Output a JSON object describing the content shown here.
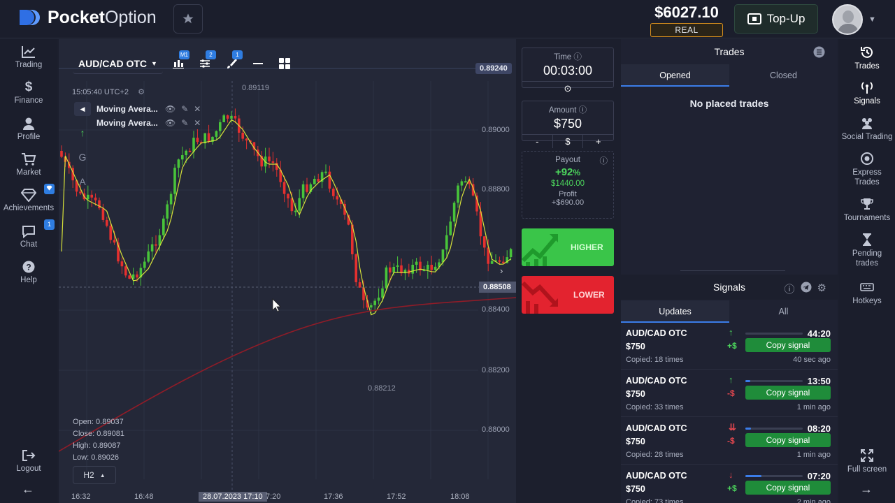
{
  "header": {
    "logo_bold": "Pocket",
    "logo_light": "Option",
    "balance": "$6027.10",
    "account_type": "REAL",
    "topup_label": "Top-Up",
    "colors": {
      "accent_blue": "#3b7de9",
      "real_badge_border": "#d78f1e"
    }
  },
  "left_nav": [
    {
      "label": "Trading",
      "icon": "chart-line-icon"
    },
    {
      "label": "Finance",
      "icon": "dollar-icon"
    },
    {
      "label": "Profile",
      "icon": "user-icon"
    },
    {
      "label": "Market",
      "icon": "cart-icon"
    },
    {
      "label": "Achievements",
      "icon": "diamond-icon",
      "badge": ""
    },
    {
      "label": "Chat",
      "icon": "chat-icon",
      "badge": "1"
    },
    {
      "label": "Help",
      "icon": "help-icon"
    }
  ],
  "left_nav_bottom": {
    "logout": "Logout"
  },
  "chart": {
    "asset": "AUD/CAD OTC",
    "toolbar_badges": {
      "chart_type": "M1",
      "indicators": "2",
      "drawings": "1"
    },
    "time": "15:05:40",
    "timezone": "UTC+2",
    "indicators": [
      {
        "label": "Moving Avera..."
      },
      {
        "label": "Moving Avera..."
      }
    ],
    "side_tools": [
      "G",
      "A"
    ],
    "ohlc": {
      "open": "Open: 0.89037",
      "close": "Close: 0.89081",
      "high": "High: 0.89087",
      "low": "Low: 0.89026"
    },
    "timeframe": "H2",
    "current_price_top": "0.89240",
    "current_price": "0.88508",
    "session_high": "0.89119",
    "session_low": "0.88212",
    "price_labels": [
      "0.89000",
      "0.88800",
      "0.88400",
      "0.88200",
      "0.88000"
    ],
    "x_labels": [
      "16:32",
      "16:48",
      "28.07.2023 17:10",
      "7:20",
      "17:36",
      "17:52",
      "18:08"
    ]
  },
  "trade_panel": {
    "time_label": "Time",
    "time_value": "00:03:00",
    "amount_label": "Amount",
    "amount_value": "$750",
    "amount_minus": "-",
    "amount_currency": "$",
    "amount_plus": "+",
    "payout_label": "Payout",
    "payout_percent": "+92",
    "payout_percent_sign": "%",
    "payout_amount": "$1440.00",
    "profit_label": "Profit",
    "profit_amount": "+$690.00",
    "higher_label": "HIGHER",
    "lower_label": "LOWER",
    "colors": {
      "higher": "#3ac549",
      "lower": "#e3232f"
    }
  },
  "trades": {
    "title": "Trades",
    "tabs": [
      "Opened",
      "Closed"
    ],
    "empty_text": "No placed trades"
  },
  "signals": {
    "title": "Signals",
    "tabs": [
      "Updates",
      "All"
    ],
    "items": [
      {
        "asset": "AUD/CAD OTC",
        "amount": "$750",
        "copied": "Copied: 18 times",
        "direction": "up",
        "delta": "+$",
        "progress": 0.0,
        "time": "44:20",
        "copy_label": "Copy signal",
        "ago": "40 sec ago"
      },
      {
        "asset": "AUD/CAD OTC",
        "amount": "$750",
        "copied": "Copied: 33 times",
        "direction": "up",
        "delta": "-$",
        "progress": 0.08,
        "time": "13:50",
        "copy_label": "Copy signal",
        "ago": "1 min ago"
      },
      {
        "asset": "AUD/CAD OTC",
        "amount": "$750",
        "copied": "Copied: 28 times",
        "direction": "down",
        "delta": "-$",
        "progress": 0.1,
        "time": "08:20",
        "copy_label": "Copy signal",
        "ago": "1 min ago"
      },
      {
        "asset": "AUD/CAD OTC",
        "amount": "$750",
        "copied": "Copied: 73 times",
        "direction": "down",
        "delta": "+$",
        "progress": 0.28,
        "time": "07:20",
        "copy_label": "Copy signal",
        "ago": "2 min ago"
      }
    ]
  },
  "right_nav": [
    {
      "label": "Trades",
      "icon": "history-icon"
    },
    {
      "label": "Signals",
      "icon": "signal-icon"
    },
    {
      "label": "Social Trading",
      "icon": "social-icon"
    },
    {
      "label": "Express Trades",
      "icon": "express-icon"
    },
    {
      "label": "Tournaments",
      "icon": "trophy-icon"
    },
    {
      "label": "Pending trades",
      "icon": "hourglass-icon"
    },
    {
      "label": "Hotkeys",
      "icon": "keyboard-icon"
    }
  ],
  "right_nav_bottom": {
    "fullscreen": "Full screen"
  }
}
